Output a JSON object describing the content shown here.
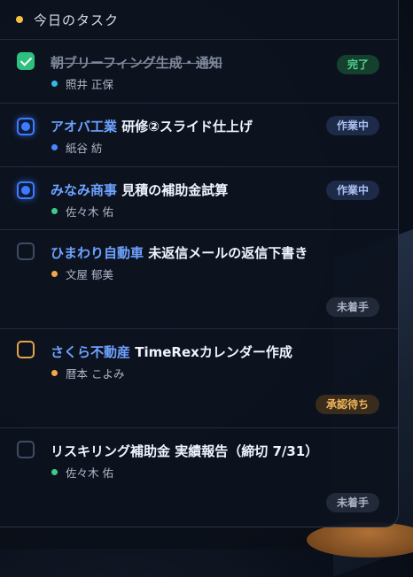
{
  "header": {
    "title": "今日のタスク"
  },
  "colors": {
    "yellow": "#f5c142",
    "cyan": "#35b8e6",
    "blue": "#4a86ff",
    "green": "#3fc98a",
    "orange": "#f0a84a"
  },
  "tasks": [
    {
      "client": "",
      "title": "朝ブリーフィング生成・通知",
      "person": "照井 正保",
      "status": "完了",
      "checkbox": "done",
      "person_color": "#35b8e6"
    },
    {
      "client": "アオバ工業",
      "title": "研修②スライド仕上げ",
      "person": "紙谷 紡",
      "status": "作業中",
      "checkbox": "in-progress",
      "person_color": "#4a86ff"
    },
    {
      "client": "みなみ商事",
      "title": "見積の補助金試算",
      "person": "佐々木 佑",
      "status": "作業中",
      "checkbox": "in-progress",
      "person_color": "#3fc98a"
    },
    {
      "client": "ひまわり自動車",
      "title": "未返信メールの返信下書き",
      "person": "文屋 郁美",
      "status": "未着手",
      "checkbox": "todo",
      "person_color": "#f0a84a"
    },
    {
      "client": "さくら不動産",
      "title": "TimeRexカレンダー作成",
      "person": "暦本 こよみ",
      "status": "承認待ち",
      "checkbox": "awaiting-approval",
      "person_color": "#f0a84a"
    },
    {
      "client": "",
      "title": "リスキリング補助金 実績報告（締切 7/31）",
      "person": "佐々木 佑",
      "status": "未着手",
      "checkbox": "todo",
      "person_color": "#3fc98a"
    }
  ]
}
